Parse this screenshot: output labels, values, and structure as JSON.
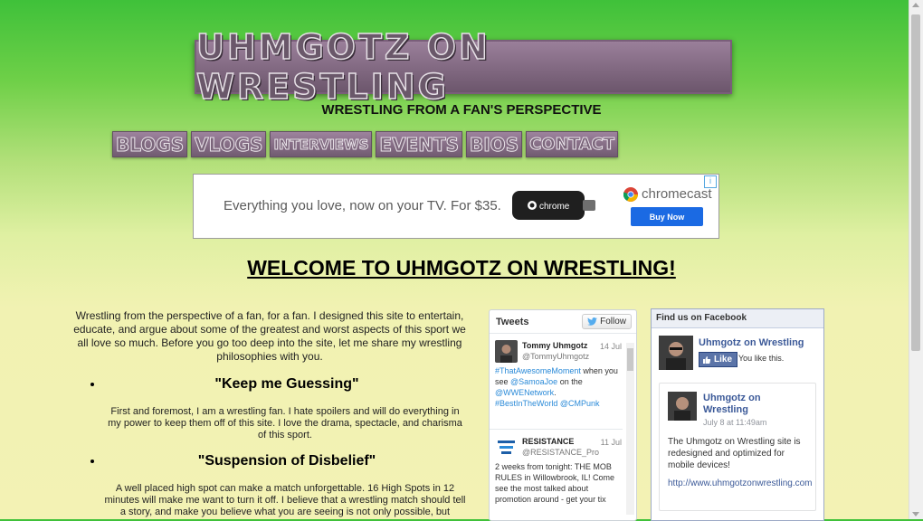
{
  "header": {
    "logo_text": "UHMGOTZ ON WRESTLING",
    "tagline": "WRESTLING FROM A FAN'S PERSPECTIVE"
  },
  "nav": [
    "BLOGS",
    "VLOGS",
    "INTERVIEWS",
    "EVENTS",
    "BIOS",
    "CONTACT"
  ],
  "ad": {
    "text": "Everything you love, now on your TV. For $35.",
    "device_label": "chrome",
    "brand": "chromecast",
    "button": "Buy Now",
    "adchoices": "i"
  },
  "welcome": "WELCOME TO UHMGOTZ ON WRESTLING!",
  "intro": "Wrestling from the perspective of a fan, for a fan. I designed this site to entertain, educate, and argue about some of the greatest and worst aspects of this sport we all love so much. Before you go too deep into the site, let me share my wrestling philosophies with you.",
  "sections": [
    {
      "heading": "\"Keep me Guessing\"",
      "text": "First and foremost, I am a wrestling fan. I hate spoilers and will do everything in my power to keep them off of this site. I love the drama, spectacle, and charisma of this sport."
    },
    {
      "heading": "\"Suspension of Disbelief\"",
      "text": "A well placed high spot can make a match unforgettable. 16 High Spots in 12 minutes will make me want to turn it off. I believe that a wrestling match should tell a story, and make you believe what you are seeing is not only possible, but"
    }
  ],
  "twitter": {
    "title": "Tweets",
    "follow": "Follow",
    "tweets": [
      {
        "name": "Tommy Uhmgotz",
        "handle": "@TommyUhmgotz",
        "date": "14 Jul",
        "body_pre_link": "#ThatAwesomeMoment",
        "body_mid": " when you see ",
        "body_link2": "@SamoaJoe",
        "body_mid2": " on the ",
        "body_link3": "@WWENetwork",
        "body_end": ".",
        "body_tags": "#BestInTheWorld @CMPunk"
      },
      {
        "name": "RESISTANCE",
        "handle": "@RESISTANCE_Pro",
        "date": "11 Jul",
        "body": "2 weeks from tonight: THE MOB RULES in Willowbrook, IL! Come see the most talked about promotion around - get your tix"
      }
    ]
  },
  "facebook": {
    "header": "Find us on Facebook",
    "page_name": "Uhmgotz on Wrestling",
    "like": "Like",
    "like_text": "You like this.",
    "post": {
      "name": "Uhmgotz on Wrestling",
      "date": "July 8 at 11:49am",
      "text": "The Uhmgotz on Wrestling site is redesigned and optimized for mobile devices!",
      "link": "http://www.uhmgotzonwrestling.com"
    }
  },
  "colors": {
    "bg_top": "#3fc13a",
    "bg_bottom": "#f3f2b4",
    "logo_purple": "#7b667b",
    "fb_blue": "#3b5998",
    "twitter_blue": "#2a8ad8"
  }
}
